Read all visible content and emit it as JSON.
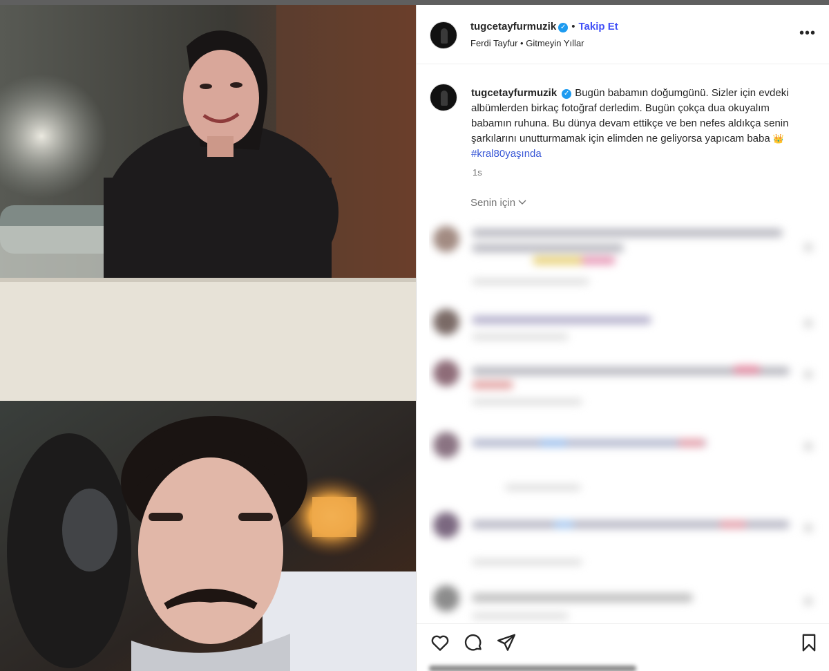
{
  "post": {
    "username": "tugcetayfurmuzik",
    "verified": true,
    "follow_label": "Takip Et",
    "separator": "•",
    "audio_artist": "Ferdi Tayfur",
    "audio_title": "Gitmeyin Yıllar",
    "more_label": "•••"
  },
  "caption": {
    "username": "tugcetayfurmuzik",
    "text": "Bugün babamın doğumgünü. Sizler için evdeki albümlerden birkaç fotoğraf derledim. Bugün çokça dua okuyalım babamın ruhuna. Bu dünya devam ettikçe ve ben nefes aldıkça senin şarkılarını unutturmamak için elimden ne geliyorsa yapıcam baba",
    "emoji": "👑",
    "hashtag": "#kral80yaşında",
    "time": "1s"
  },
  "comments": {
    "filter_label": "Senin için ",
    "filter_icon": "chevron-down-icon",
    "blurred": true
  },
  "actions": {
    "like_icon": "heart-icon",
    "comment_icon": "comment-icon",
    "share_icon": "send-icon",
    "save_icon": "bookmark-icon"
  },
  "colors": {
    "accent": "#4150f7",
    "hashtag": "#3857d6",
    "verified": "#1d9bf0",
    "muted": "#737373"
  }
}
